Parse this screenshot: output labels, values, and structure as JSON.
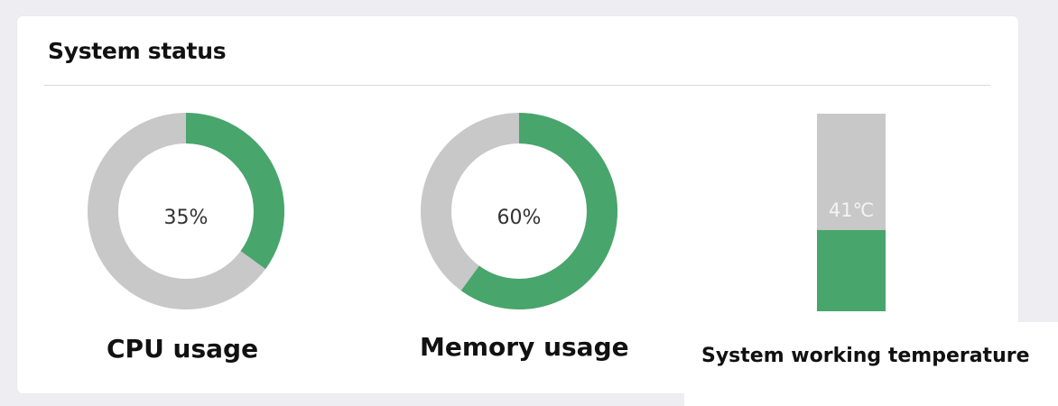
{
  "panel": {
    "title": "System status"
  },
  "metrics": [
    {
      "name": "CPU usage",
      "percent": 35,
      "value_text": "35%"
    },
    {
      "name": "Memory usage",
      "percent": 60,
      "value_text": "60%"
    }
  ],
  "temperature": {
    "label": "System working temperature",
    "value_text": "41℃",
    "level_percent": 41
  },
  "colors": {
    "fill": "#48a56c",
    "track": "#c8c8c8"
  }
}
